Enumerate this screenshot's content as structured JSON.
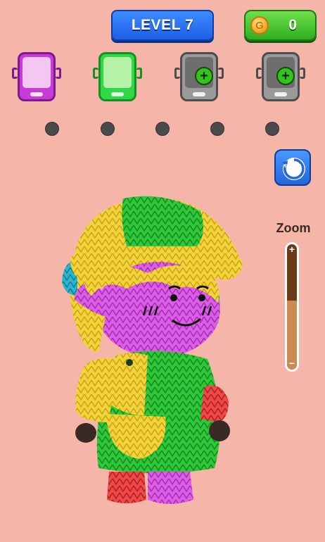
{
  "hud": {
    "level_label": "LEVEL 7",
    "coin_symbol": "G",
    "coin_count": "0"
  },
  "slots": [
    {
      "state": "filled",
      "color": "#c83bd6",
      "name": "purple"
    },
    {
      "state": "filled",
      "color": "#2fd944",
      "name": "green"
    },
    {
      "state": "locked",
      "icon": "plus-icon"
    },
    {
      "state": "locked",
      "icon": "plus-icon"
    }
  ],
  "progress_dots": 5,
  "reset": {
    "label": "RESET",
    "icon": "reset-arrow-icon"
  },
  "zoom": {
    "label": "Zoom",
    "plus": "+",
    "minus": "−",
    "level": 0.55
  }
}
